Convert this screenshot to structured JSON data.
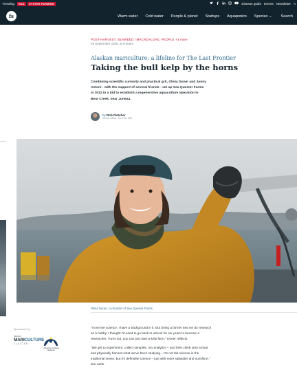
{
  "trending": {
    "label": "Trending:",
    "tags": [
      "RAS",
      "OYSTER FARMING"
    ],
    "links": [
      "Disease guide",
      "Events",
      "Newsletter",
      "A"
    ]
  },
  "nav": {
    "logo": "fs",
    "items": [
      "Warm water",
      "Cold water",
      "People & planet",
      "Startups",
      "Aquaponics",
      "Species ⌄",
      "Search"
    ]
  },
  "article": {
    "categories": "POST-HARVEST, SEAWEED / MACROALGAE, PEOPLE +3 more",
    "date": "29 September 2025, at 8:00am",
    "kicker": "Alaskan mariculture: a lifeline for The Last Frontier",
    "headline": "Taking the bull kelp by the horns",
    "standfirst": "Combining scientific curiosity and practical grit, Olivia Duner and Jonny Antoni - with the support of several friends - set up Sea Quester Farms in 2022 in a bid to establish a regenerative aquaculture operation in Bear Creek, near Juneau.",
    "byline_prefix": "by",
    "author": "Rob Fletcher",
    "author_role": "Senior editor, The Fish Site",
    "caption": "Olivia Duner, co-founder of Sea Quester Farms",
    "paragraphs": [
      "\"I love the science. I have a background in it. But being a farmer lets me do research as a hobby. I thought I'd need to go back to school for six years to become a researcher. Turns out, you can just start a kelp farm,\" Duner reflects.",
      "\"We get to experiment, collect samples, run analytics – and then climb onto a boat and physically harvest what we've been studying... It's not lab science in the traditional sense, but it's definitely science – just with more saltwater and sunshine,\" she adds."
    ]
  },
  "sidebar": {
    "sponsored": "Sponsored by",
    "mariculture_top": "Alaska",
    "mariculture_main_1": "MARI",
    "mariculture_main_2": "CULTURE",
    "mariculture_sub": "CLUSTER",
    "uaf": "University of Alaska Fairbanks"
  },
  "colors": {
    "nav_bg": "#12232e",
    "accent_red": "#c8102e",
    "link_blue": "#2f6a8e"
  },
  "icons": [
    "twitter-icon",
    "facebook-icon",
    "linkedin-icon",
    "instagram-icon",
    "youtube-icon"
  ]
}
